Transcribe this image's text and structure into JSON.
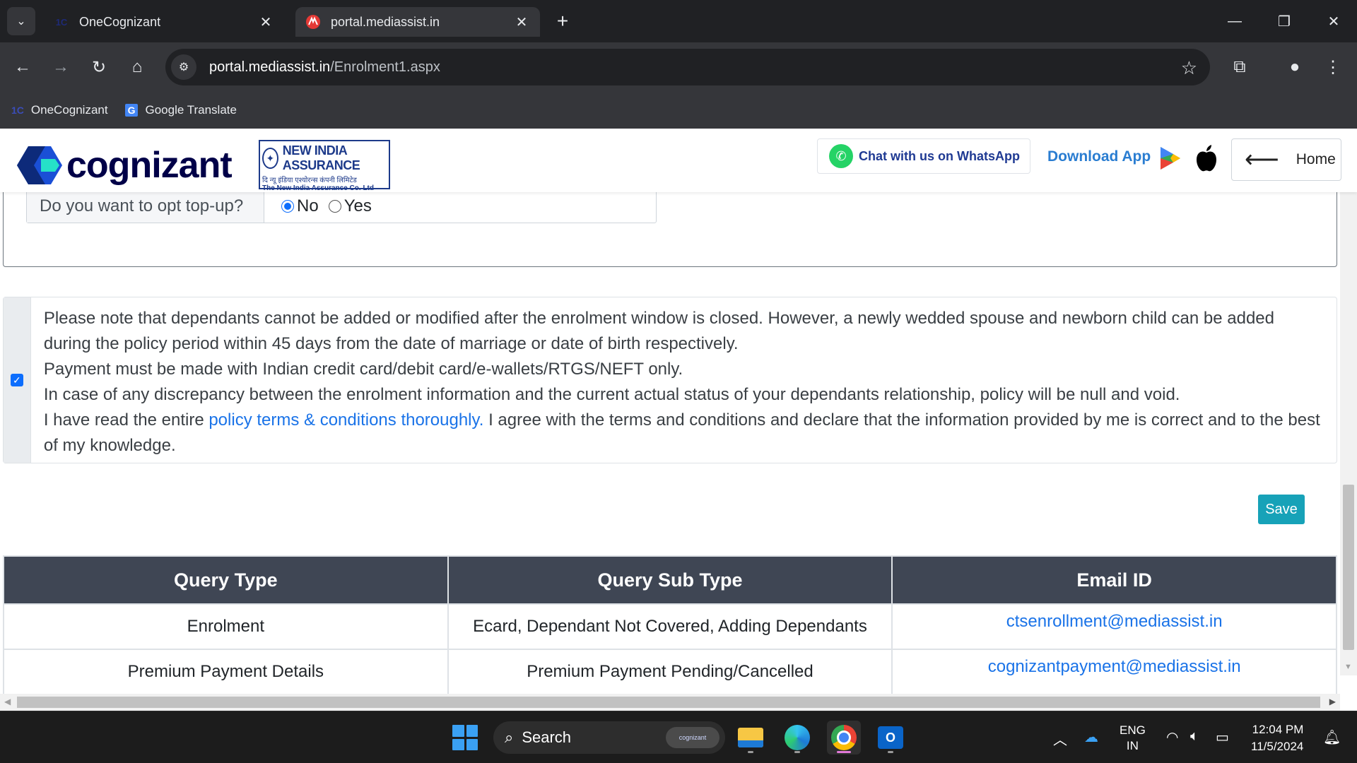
{
  "browser": {
    "tabs": [
      {
        "title": "OneCognizant",
        "favicon": "onecognizant-icon",
        "active": false
      },
      {
        "title": "portal.mediassist.in",
        "favicon": "mediassist-icon",
        "active": true
      }
    ],
    "url_host": "portal.mediassist.in",
    "url_path": "/Enrolment1.aspx",
    "bookmarks": [
      {
        "label": "OneCognizant",
        "icon": "1C"
      },
      {
        "label": "Google Translate",
        "icon": "G"
      }
    ]
  },
  "header": {
    "logo_text": "cognizant",
    "insurer": {
      "name": "NEW INDIA ASSURANCE",
      "hindi": "दि न्यू इंडिया एश्योरन्स कंपनी लिमिटेड",
      "sub": "The New India Assurance Co. Ltd"
    },
    "whatsapp_label": "Chat with us on WhatsApp",
    "download_label": "Download App",
    "home_label": "Home"
  },
  "topup": {
    "question": "Do you want to opt top-up?",
    "options": [
      {
        "label": "No",
        "selected": true
      },
      {
        "label": "Yes",
        "selected": false
      }
    ]
  },
  "declaration": {
    "checked": true,
    "line1": "Please note that dependants cannot be added or modified after the enrolment window is closed. However, a newly wedded spouse and newborn child can be added during the policy period within 45 days from the date of marriage or date of birth respectively.",
    "line2": "Payment must be made with Indian credit card/debit card/e-wallets/RTGS/NEFT only.",
    "line3": "In case of any discrepancy between the enrolment information and the current actual status of your dependants relationship, policy will be null and void.",
    "line4_prefix": "I have read the entire ",
    "line4_link": "policy terms & conditions thoroughly.",
    "line4_suffix": " I agree with the terms and conditions and declare that the information provided by me is correct and to the best of my knowledge."
  },
  "save_label": "Save",
  "query_table": {
    "headers": [
      "Query Type",
      "Query Sub Type",
      "Email ID"
    ],
    "rows": [
      {
        "type": "Enrolment",
        "sub_type": "Ecard, Dependant Not Covered, Adding Dependants",
        "email": "ctsenrollment@mediassist.in"
      },
      {
        "type": "Premium Payment Details",
        "sub_type": "Premium Payment Pending/Cancelled",
        "email": "cognizantpayment@mediassist.in"
      }
    ]
  },
  "taskbar": {
    "search_placeholder": "Search",
    "search_badge": "cognizant",
    "language_line1": "ENG",
    "language_line2": "IN",
    "time": "12:04 PM",
    "date": "11/5/2024"
  },
  "colors": {
    "brand_navy": "#000048",
    "table_header": "#3f4654",
    "save_button": "#17a2b8",
    "link": "#1a73e8"
  }
}
